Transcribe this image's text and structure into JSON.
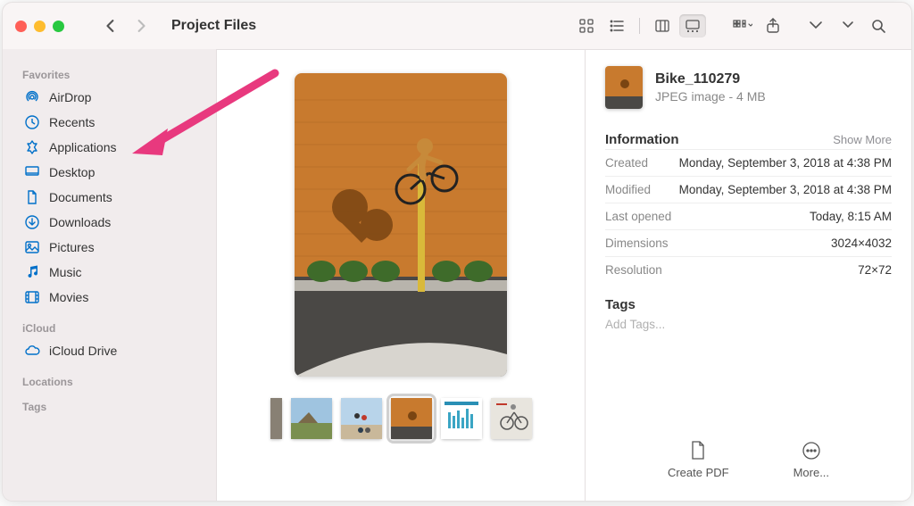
{
  "window": {
    "title": "Project Files"
  },
  "sidebar": {
    "sections": [
      {
        "label": "Favorites",
        "items": [
          {
            "icon": "airdrop-icon",
            "label": "AirDrop"
          },
          {
            "icon": "clock-icon",
            "label": "Recents"
          },
          {
            "icon": "apps-icon",
            "label": "Applications"
          },
          {
            "icon": "desktop-icon",
            "label": "Desktop"
          },
          {
            "icon": "documents-icon",
            "label": "Documents"
          },
          {
            "icon": "downloads-icon",
            "label": "Downloads"
          },
          {
            "icon": "pictures-icon",
            "label": "Pictures"
          },
          {
            "icon": "music-icon",
            "label": "Music"
          },
          {
            "icon": "movies-icon",
            "label": "Movies"
          }
        ]
      },
      {
        "label": "iCloud",
        "items": [
          {
            "icon": "icloud-icon",
            "label": "iCloud Drive"
          }
        ]
      },
      {
        "label": "Locations",
        "items": []
      },
      {
        "label": "Tags",
        "items": []
      }
    ]
  },
  "details": {
    "filename": "Bike_110279",
    "subtitle": "JPEG image - 4 MB",
    "info_heading": "Information",
    "show_more": "Show More",
    "rows": [
      {
        "k": "Created",
        "v": "Monday, September 3, 2018 at 4:38 PM"
      },
      {
        "k": "Modified",
        "v": "Monday, September 3, 2018 at 4:38 PM"
      },
      {
        "k": "Last opened",
        "v": "Today, 8:15 AM"
      },
      {
        "k": "Dimensions",
        "v": "3024×4032"
      },
      {
        "k": "Resolution",
        "v": "72×72"
      }
    ],
    "tags_heading": "Tags",
    "add_tags": "Add Tags...",
    "actions": {
      "createpdf": "Create PDF",
      "more": "More..."
    }
  },
  "colors": {
    "accent": "#0070c9",
    "annotation": "#e8397e"
  }
}
